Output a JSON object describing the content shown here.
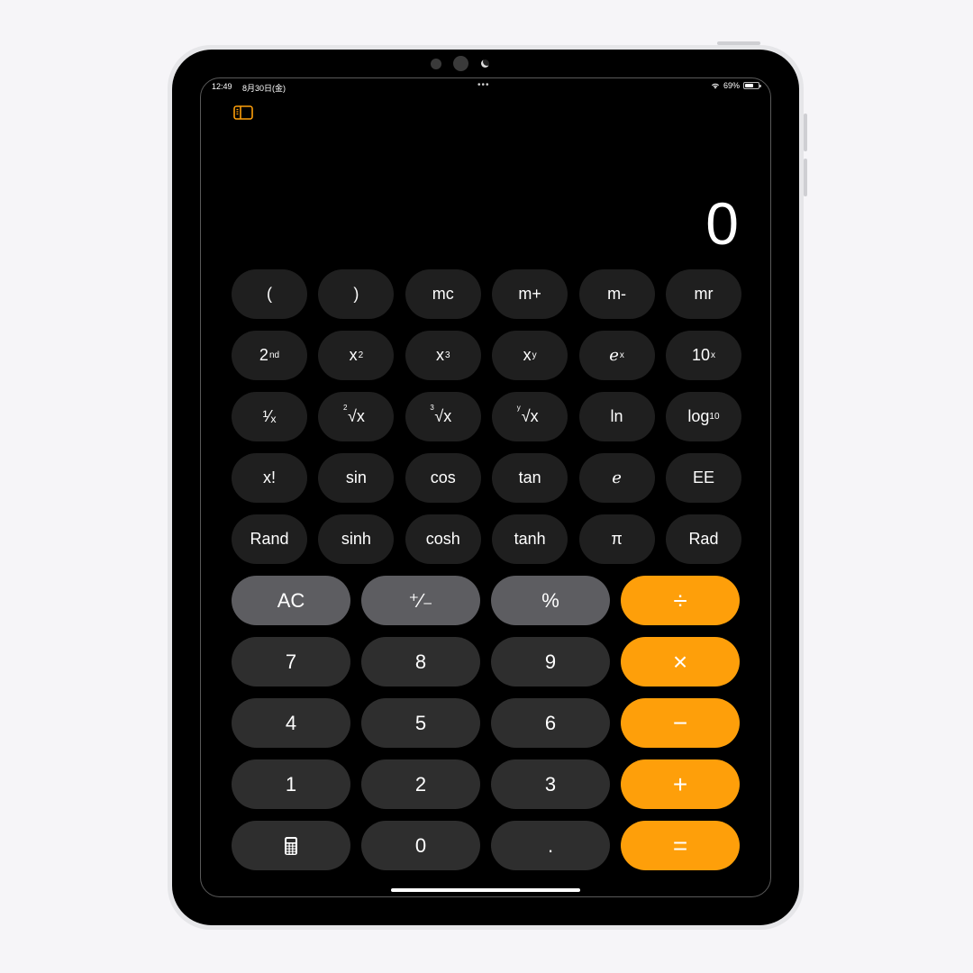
{
  "status_bar": {
    "time": "12:49",
    "date": "8月30日(金)",
    "multitask_dots": "•••",
    "battery_percent": "69%",
    "battery_level": 0.69,
    "wifi_icon": "wifi-icon"
  },
  "toolbar": {
    "sidebar_icon": "sidebar-icon",
    "accent_color": "#fe9f0a"
  },
  "display": {
    "value": "0"
  },
  "scientific_keys": [
    [
      {
        "label": "(",
        "name": "open-paren"
      },
      {
        "label": ")",
        "name": "close-paren"
      },
      {
        "label": "mc",
        "name": "memory-clear"
      },
      {
        "label": "m+",
        "name": "memory-add"
      },
      {
        "label": "m-",
        "name": "memory-subtract"
      },
      {
        "label": "mr",
        "name": "memory-recall"
      }
    ],
    [
      {
        "label": "2",
        "sup": "nd",
        "name": "second-function"
      },
      {
        "label": "x",
        "sup": "2",
        "name": "square"
      },
      {
        "label": "x",
        "sup": "3",
        "name": "cube"
      },
      {
        "label": "x",
        "sup": "y",
        "name": "power"
      },
      {
        "label": "e",
        "sup": "x",
        "name": "exp",
        "italic": true
      },
      {
        "label": "10",
        "sup": "x",
        "name": "ten-power"
      }
    ],
    [
      {
        "label": "¹⁄ₓ",
        "name": "reciprocal"
      },
      {
        "label": "√x",
        "index": "2",
        "name": "square-root"
      },
      {
        "label": "√x",
        "index": "3",
        "name": "cube-root"
      },
      {
        "label": "√x",
        "index": "y",
        "name": "y-root"
      },
      {
        "label": "ln",
        "name": "natural-log"
      },
      {
        "label": "log",
        "sub": "10",
        "name": "log-ten"
      }
    ],
    [
      {
        "label": "x!",
        "name": "factorial"
      },
      {
        "label": "sin",
        "name": "sin"
      },
      {
        "label": "cos",
        "name": "cos"
      },
      {
        "label": "tan",
        "name": "tan"
      },
      {
        "label": "e",
        "name": "euler",
        "italic": true
      },
      {
        "label": "EE",
        "name": "exponent-entry"
      }
    ],
    [
      {
        "label": "Rand",
        "name": "random"
      },
      {
        "label": "sinh",
        "name": "sinh"
      },
      {
        "label": "cosh",
        "name": "cosh"
      },
      {
        "label": "tanh",
        "name": "tanh"
      },
      {
        "label": "π",
        "name": "pi"
      },
      {
        "label": "Rad",
        "name": "radians-toggle"
      }
    ]
  ],
  "basic_keys": [
    [
      {
        "label": "AC",
        "name": "all-clear",
        "kind": "fn"
      },
      {
        "label": "⁺∕₋",
        "name": "plus-minus",
        "kind": "fn"
      },
      {
        "label": "%",
        "name": "percent",
        "kind": "fn"
      },
      {
        "label": "÷",
        "name": "divide",
        "kind": "op"
      }
    ],
    [
      {
        "label": "7",
        "name": "digit-7"
      },
      {
        "label": "8",
        "name": "digit-8"
      },
      {
        "label": "9",
        "name": "digit-9"
      },
      {
        "label": "×",
        "name": "multiply",
        "kind": "op"
      }
    ],
    [
      {
        "label": "4",
        "name": "digit-4"
      },
      {
        "label": "5",
        "name": "digit-5"
      },
      {
        "label": "6",
        "name": "digit-6"
      },
      {
        "label": "−",
        "name": "subtract",
        "kind": "op"
      }
    ],
    [
      {
        "label": "1",
        "name": "digit-1"
      },
      {
        "label": "2",
        "name": "digit-2"
      },
      {
        "label": "3",
        "name": "digit-3"
      },
      {
        "label": "+",
        "name": "add",
        "kind": "op"
      }
    ],
    [
      {
        "label": "",
        "name": "calculator-mode",
        "icon": "calculator-icon"
      },
      {
        "label": "0",
        "name": "digit-0"
      },
      {
        "label": ".",
        "name": "decimal-point"
      },
      {
        "label": "=",
        "name": "equals",
        "kind": "op"
      }
    ]
  ]
}
